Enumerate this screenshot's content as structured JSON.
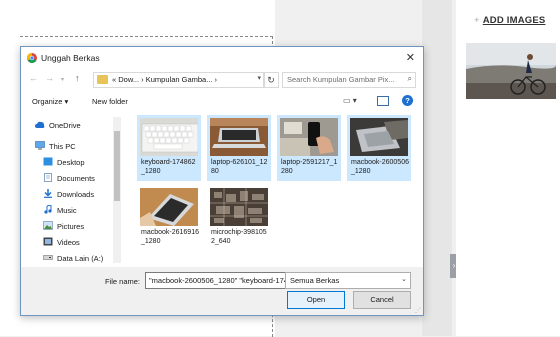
{
  "background": {
    "add_images_label": "ADD IMAGES",
    "plus_icon": "plus-icon",
    "collapse_icon": "chevron-right-icon"
  },
  "dialog": {
    "title": "Unggah Berkas",
    "close_icon": "close-icon",
    "nav": {
      "back_icon": "arrow-left-icon",
      "forward_icon": "arrow-right-icon",
      "recent_icon": "chevron-down-icon",
      "up_icon": "arrow-up-icon",
      "address_text": "« Dow...  ›  Kumpulan Gamba...  ›",
      "search_placeholder": "Search Kumpulan Gambar Pix..."
    },
    "toolbar": {
      "organize_label": "Organize ▾",
      "new_folder_label": "New folder"
    },
    "sidebar": [
      {
        "label": "OneDrive",
        "icon": "cloud-icon"
      },
      {
        "label": "This PC",
        "icon": "computer-icon"
      },
      {
        "label": "Desktop",
        "icon": "desktop-icon"
      },
      {
        "label": "Documents",
        "icon": "document-icon"
      },
      {
        "label": "Downloads",
        "icon": "download-icon"
      },
      {
        "label": "Music",
        "icon": "music-icon"
      },
      {
        "label": "Pictures",
        "icon": "pictures-icon"
      },
      {
        "label": "Videos",
        "icon": "video-icon"
      },
      {
        "label": "Data Lain (A:)",
        "icon": "drive-icon"
      }
    ],
    "files": [
      {
        "name": "keyboard-174862_1280",
        "selected": true
      },
      {
        "name": "laptop-626101_1280",
        "selected": true
      },
      {
        "name": "laptop-2591217_1280",
        "selected": true
      },
      {
        "name": "macbook-2600506_1280",
        "selected": true
      },
      {
        "name": "macbook-2616916_1280",
        "selected": false
      },
      {
        "name": "microchip-3981052_640",
        "selected": false
      }
    ],
    "bottom": {
      "file_name_label": "File name:",
      "file_name_value": "\"macbook-2600506_1280\" \"keyboard-174862_1280\"",
      "file_type_value": "Semua Berkas",
      "open_label": "Open",
      "cancel_label": "Cancel"
    }
  }
}
